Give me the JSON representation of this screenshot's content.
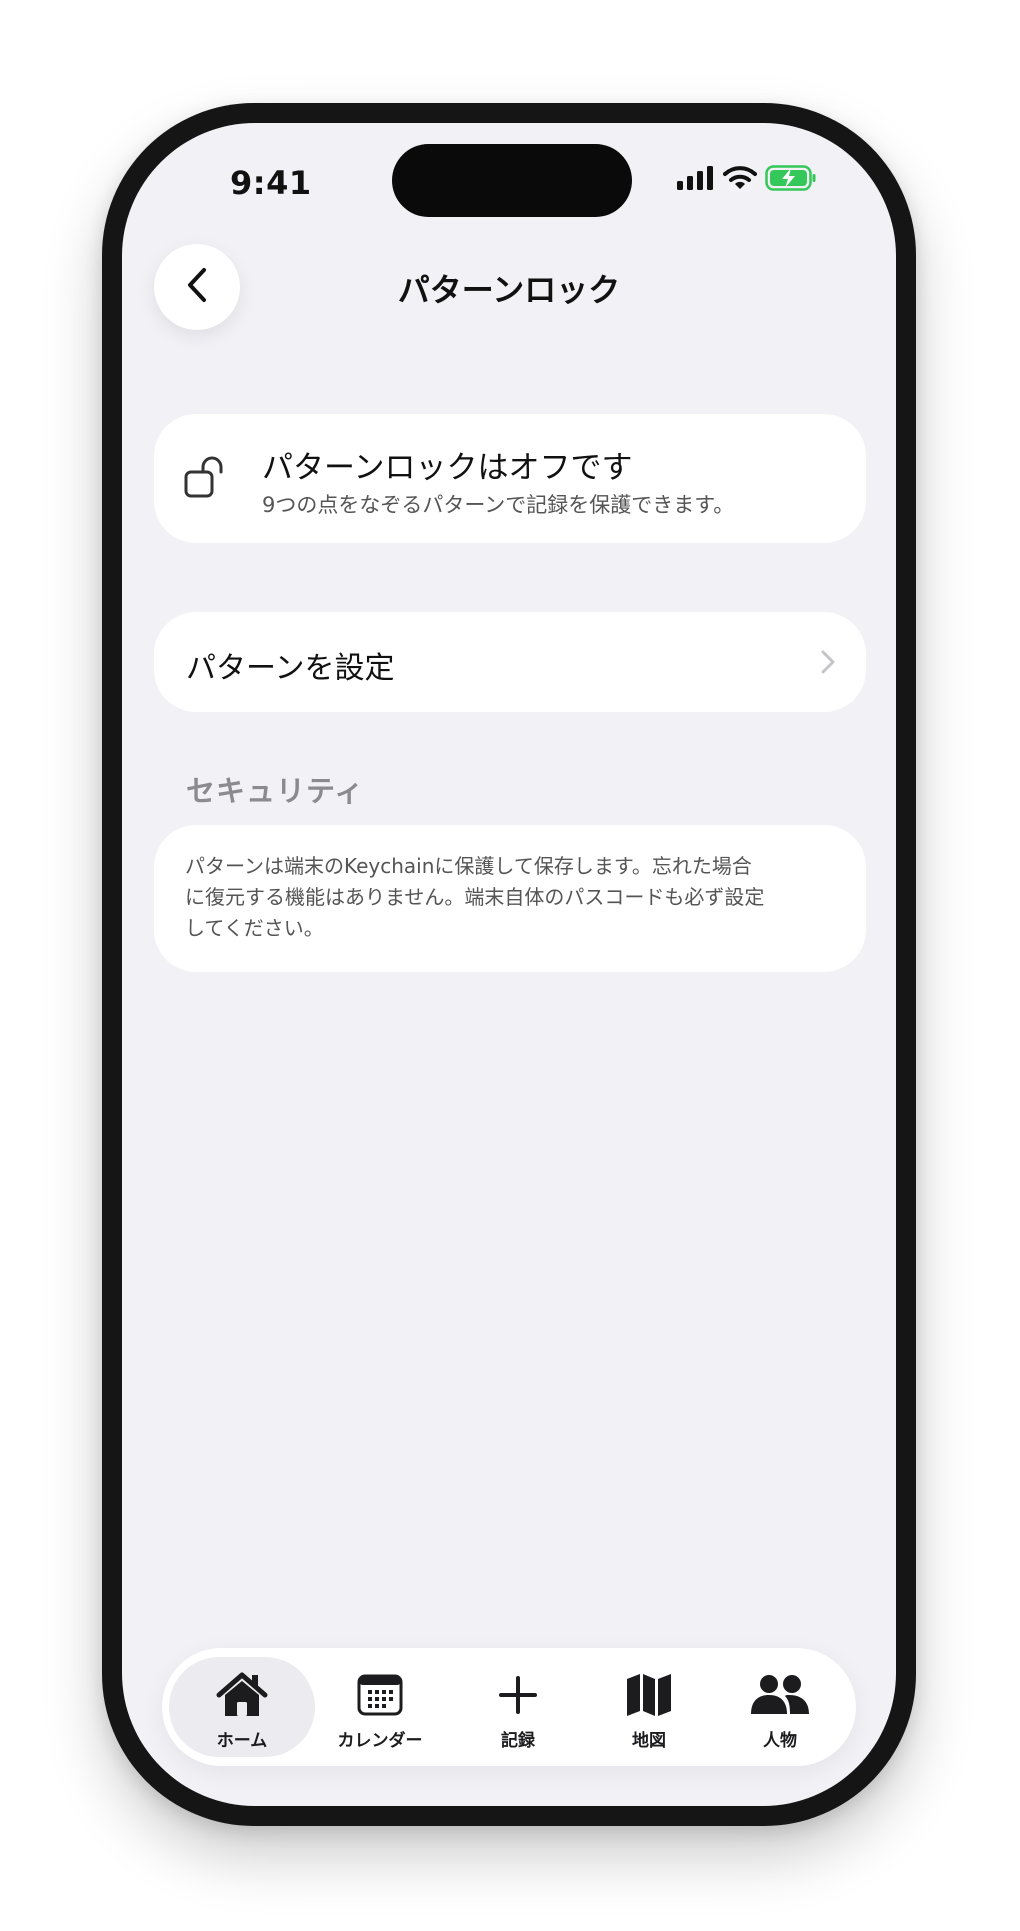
{
  "status_bar": {
    "time": "9:41"
  },
  "nav": {
    "title": "パターンロック"
  },
  "lock_status": {
    "title": "パターンロックはオフです",
    "description": "9つの点をなぞるパターンで記録を保護できます。"
  },
  "set_pattern": {
    "label": "パターンを設定"
  },
  "security": {
    "header": "セキュリティ",
    "lines": [
      "パターンは端末のKeychainに保護して保存します。忘れた場合",
      "に復元する機能はありません。端末自体のパスコードも必ず設定",
      "してください。"
    ]
  },
  "tabs": [
    {
      "label": "ホーム",
      "icon": "house-icon",
      "active": true
    },
    {
      "label": "カレンダー",
      "icon": "calendar-icon",
      "active": false
    },
    {
      "label": "記録",
      "icon": "plus-icon",
      "active": false
    },
    {
      "label": "地図",
      "icon": "map-icon",
      "active": false
    },
    {
      "label": "人物",
      "icon": "people-icon",
      "active": false
    }
  ],
  "colors": {
    "background": "#f1f1f6",
    "card": "#ffffff",
    "battery_green": "#34c759",
    "text_primary": "#111111",
    "text_secondary": "#555555",
    "section_header": "#8a8a8f"
  }
}
